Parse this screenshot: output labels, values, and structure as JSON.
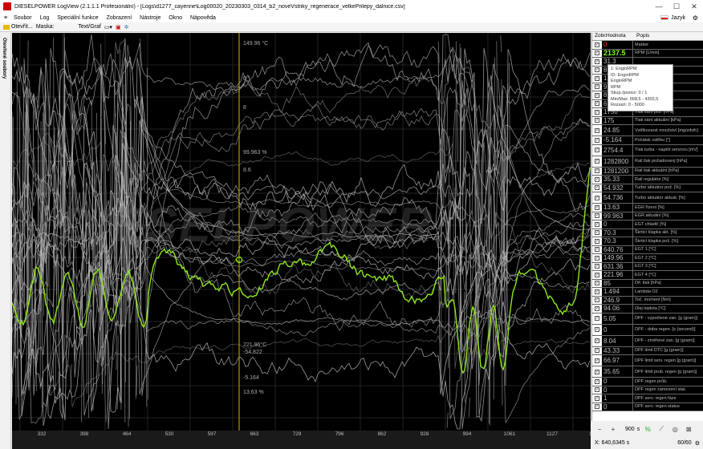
{
  "window": {
    "title": "DIESELPOWER LogView (2.1.1.1 Profesionální) - [Logs\\d1277_cayenne\\Log00020_20230303_0314_b2_noveVstriky_regenerace_velkePrilepy_dalnice.csv]",
    "minimize": "—",
    "maximize": "☐",
    "close": "✕"
  },
  "menu": {
    "items": [
      "Soubor",
      "Log",
      "Speciální funkce",
      "Zobrazení",
      "Nástroje",
      "Okno",
      "Nápověda"
    ],
    "language": "Jazyk"
  },
  "toolbar": {
    "open": "Otevřít...",
    "mask": "Maska:",
    "view_mode": "Text/Graf"
  },
  "sidebar": {
    "label": "Otevřené soubory"
  },
  "watermark": "DIESELPOWER",
  "plot": {
    "cursor_labels": [
      {
        "text": "149.96 °C",
        "y": 10
      },
      {
        "text": "0 °",
        "y": 54
      },
      {
        "text": "8",
        "y": 90
      },
      {
        "text": "99.963 %",
        "y": 146
      },
      {
        "text": "8.6",
        "y": 168
      },
      {
        "text": "-5.164",
        "y": 427
      },
      {
        "text": "13.63 %",
        "y": 445
      },
      {
        "text": "-54.822",
        "y": 395
      },
      {
        "text": "221.96°C",
        "y": 386
      }
    ],
    "x_ticks": [
      "332",
      "398",
      "464",
      "530",
      "597",
      "663",
      "729",
      "796",
      "862",
      "928",
      "994",
      "1061",
      "1127",
      "1193"
    ]
  },
  "panel": {
    "headers": [
      "Zobr.",
      "Hodnota",
      "Popis"
    ],
    "rows": [
      {
        "value": "0",
        "desc": "Marker",
        "color": "#ff3030"
      },
      {
        "value": "2137.5",
        "desc": "RPM [1/min]",
        "color": "#80ff20"
      },
      {
        "value": "31.3",
        "desc": ""
      },
      {
        "value": "8",
        "desc": ""
      },
      {
        "value": "131",
        "desc": ""
      },
      {
        "value": "92",
        "desc": ""
      },
      {
        "value": "83.2",
        "desc": ""
      },
      {
        "value": "692",
        "desc": ""
      },
      {
        "value": "1750",
        "desc": "Tlak sání pož. [hPa]"
      },
      {
        "value": "175",
        "desc": "Tlak sání aktuální [kPa]"
      },
      {
        "value": "24.85",
        "desc": "Vstřikované množství [mg/zdvih]"
      },
      {
        "value": "-5.164",
        "desc": "Počátek vstřiku [°]"
      },
      {
        "value": "2754.4",
        "desc": "Tlak turba - napětí senzoru [mV]"
      },
      {
        "value": "1282800",
        "desc": "Rail tlak požadovaný [hPa]"
      },
      {
        "value": "1281200",
        "desc": "Rail tlak aktuální [hPa]"
      },
      {
        "value": "35.33",
        "desc": "Rail regulátor [%]"
      },
      {
        "value": "54.932",
        "desc": "Turbo aktuátor pož. [%]"
      },
      {
        "value": "54.736",
        "desc": "Turbo aktuátor aktuál. [%]"
      },
      {
        "value": "13.63",
        "desc": "EGR řízení [%]"
      },
      {
        "value": "99.963",
        "desc": "EGR aktuální [%]"
      },
      {
        "value": "0",
        "desc": "EGT chladič [%]"
      },
      {
        "value": "70.3",
        "desc": "Škrticí klapka akt. [%]"
      },
      {
        "value": "70.3",
        "desc": "Škrticí klapka pož. [%]"
      },
      {
        "value": "640.76",
        "desc": "EGT 1 [°C]"
      },
      {
        "value": "149.96",
        "desc": "EGT 2 [°C]"
      },
      {
        "value": "631.36",
        "desc": "EGT 3 [°C]"
      },
      {
        "value": "221.96",
        "desc": "EGT 4 [°C]"
      },
      {
        "value": "85",
        "desc": "Dif. tlak [hPa]"
      },
      {
        "value": "1.494",
        "desc": "Lambda O2"
      },
      {
        "value": "246.9",
        "desc": "Toč. moment [Nm]"
      },
      {
        "value": "94.06",
        "desc": "Olej teplota [°C]"
      },
      {
        "value": "5.05",
        "desc": "DPF - vypočtené zan. [g (gram)]"
      },
      {
        "value": "0",
        "desc": "DPF - doba regen. [s (second)]"
      },
      {
        "value": "8.04",
        "desc": "DPF - změřené zan. [g (gram)]"
      },
      {
        "value": "43.33",
        "desc": "DPF limit DTC [g (gram)]"
      },
      {
        "value": "66.97",
        "desc": "DPF limit serv. regen [g (gram)]"
      },
      {
        "value": "35.65",
        "desc": "DPF limit prub. regen [g (gram)]"
      },
      {
        "value": "0",
        "desc": "DPF regen průb."
      },
      {
        "value": "0",
        "desc": "DPF regen zamezení stat."
      },
      {
        "value": "1",
        "desc": "DPF serv. regen fáze"
      },
      {
        "value": "0",
        "desc": "DPF serv. regen status"
      }
    ]
  },
  "tooltip": {
    "lines": [
      "1: EnginRPM",
      "ID: EnginRPM",
      "EnginRPM",
      "RPM",
      "Skup./pozice: 0 / 1",
      "Min/Max: 668,5 - 4302,5",
      "Rozsah: 0 - 5000"
    ]
  },
  "controls": {
    "zoom_value": "900",
    "zoom_unit": "s",
    "coords": "X: 640,6345 s",
    "page": "60/60"
  },
  "colors": {
    "rpm_trace": "#8ee61e",
    "cursor": "#d4b000",
    "traces": "#b8b8b8"
  }
}
